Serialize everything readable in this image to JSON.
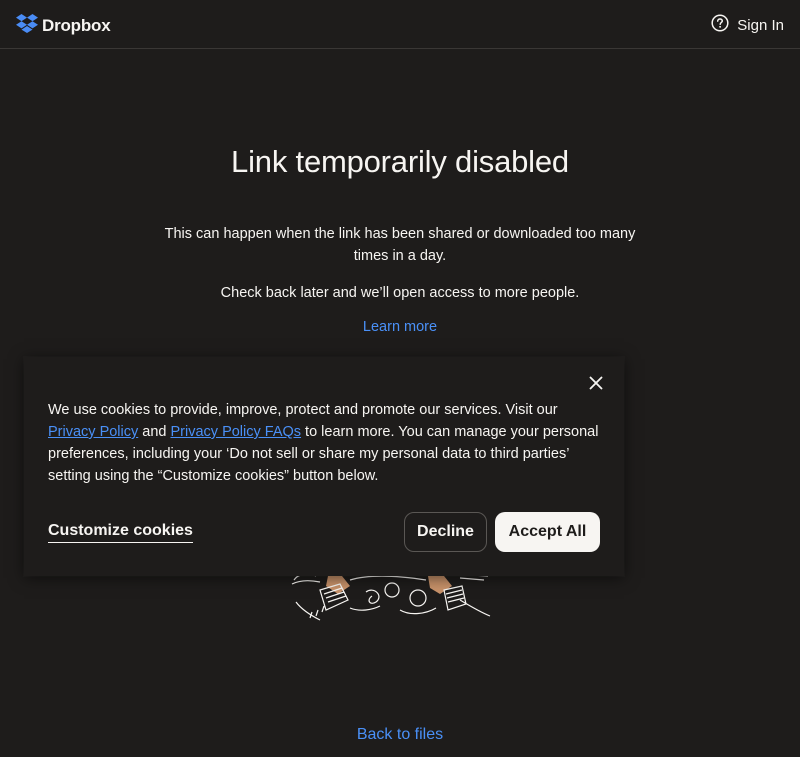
{
  "header": {
    "logo_text": "Dropbox",
    "signin_label": "Sign In"
  },
  "main": {
    "title": "Link temporarily disabled",
    "description": "This can happen when the link has been shared or downloaded too many times in a day.",
    "description2": "Check back later and we’ll open access to more people.",
    "learn_more": "Learn more",
    "back_to_files": "Back to files"
  },
  "cookie_banner": {
    "text_before_link1": "We use cookies to provide, improve, protect and promote our services. Visit our ",
    "link1": "Privacy Policy",
    "text_between": " and ",
    "link2": "Privacy Policy FAQs",
    "text_after": " to learn more. You can manage your personal preferences, including your ‘Do not sell or share my personal data to third parties’ setting using the “Customize cookies” button below.",
    "customize_label": "Customize cookies",
    "decline_label": "Decline",
    "accept_label": "Accept All"
  },
  "icons": {
    "logo": "dropbox-logo-icon",
    "help": "help-circle-icon",
    "close": "close-icon"
  },
  "colors": {
    "background": "#1e1c1b",
    "text": "#f7f5f2",
    "link": "#4a90f7",
    "skin": "#c8926a"
  }
}
